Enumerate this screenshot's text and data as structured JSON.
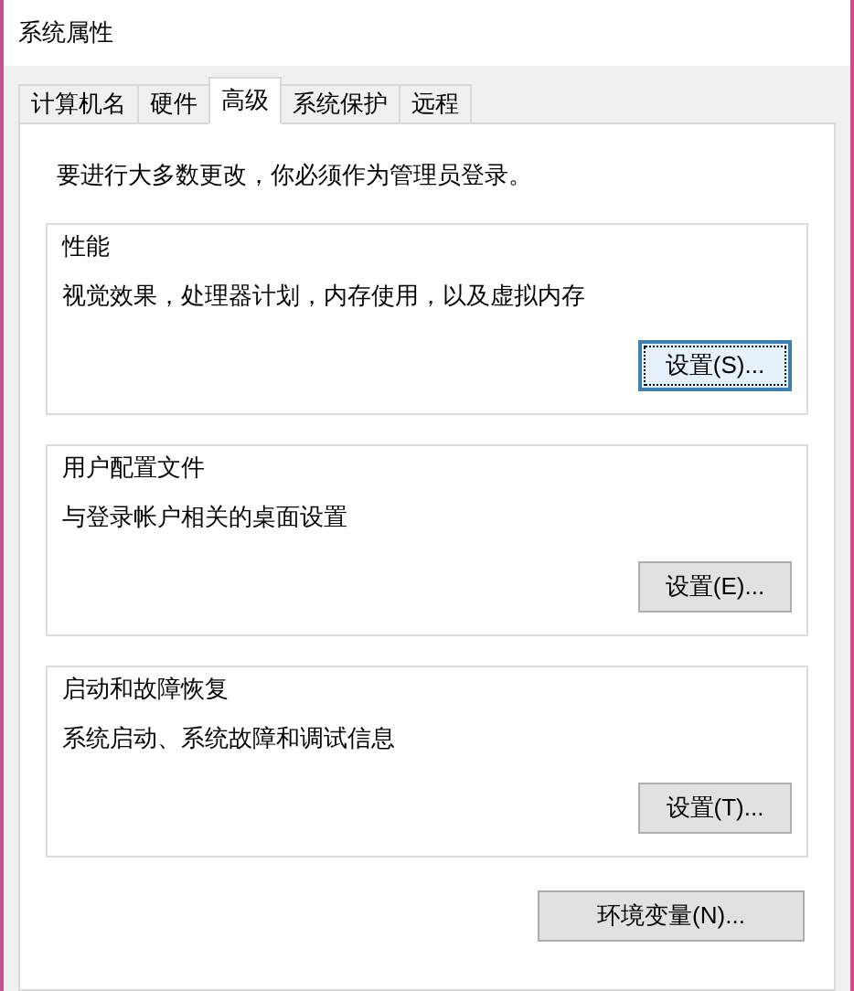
{
  "window": {
    "title": "系统属性"
  },
  "tabs": [
    {
      "label": "计算机名",
      "selected": false
    },
    {
      "label": "硬件",
      "selected": false
    },
    {
      "label": "高级",
      "selected": true
    },
    {
      "label": "系统保护",
      "selected": false
    },
    {
      "label": "远程",
      "selected": false
    }
  ],
  "notice": "要进行大多数更改，你必须作为管理员登录。",
  "groups": [
    {
      "title": "性能",
      "description": "视觉效果，处理器计划，内存使用，以及虚拟内存",
      "button": {
        "label": "设置(S)...",
        "focused": true
      }
    },
    {
      "title": "用户配置文件",
      "description": "与登录帐户相关的桌面设置",
      "button": {
        "label": "设置(E)...",
        "focused": false
      }
    },
    {
      "title": "启动和故障恢复",
      "description": "系统启动、系统故障和调试信息",
      "button": {
        "label": "设置(T)...",
        "focused": false
      }
    }
  ],
  "env_button": {
    "label": "环境变量(N)...",
    "focused": false
  }
}
